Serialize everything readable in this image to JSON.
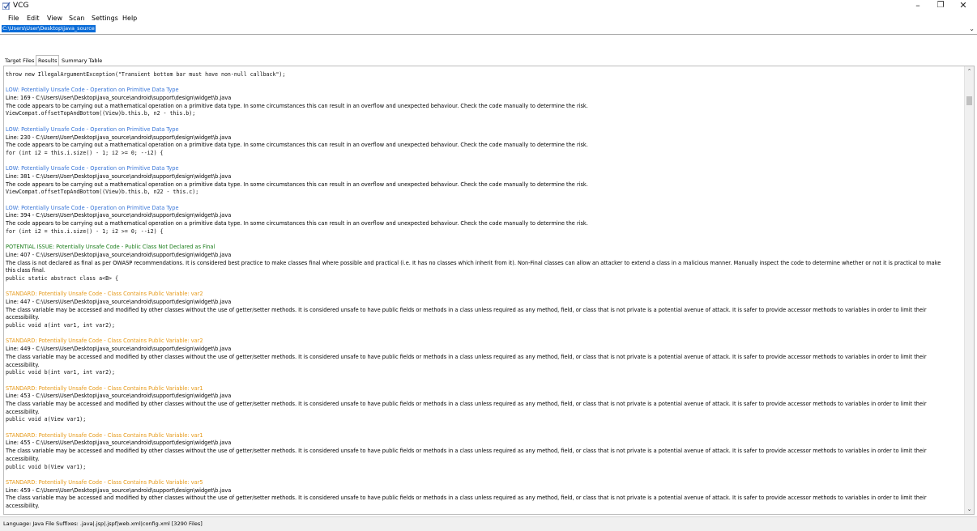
{
  "window": {
    "title": "VCG",
    "minimize": "–",
    "maximize": "❐",
    "close": "✕"
  },
  "menu": [
    "File",
    "Edit",
    "View",
    "Scan",
    "Settings",
    "Help"
  ],
  "path": {
    "value": "C:\\Users\\User\\Desktop\\java_source",
    "dropdown": "⌄"
  },
  "tabs": [
    "Target Files",
    "Results",
    "Summary Table"
  ],
  "scrollbar": {
    "up": "⌃",
    "down": "⌄"
  },
  "results": {
    "top_code": "    throw new IllegalArgumentException(\"Transient bottom bar must have non-null callback\");",
    "entries": [
      {
        "heading": "LOW: Potentially Unsafe Code - Operation on Primitive Data Type",
        "line": "Line: 169 - C:\\Users\\User\\Desktop\\java_source\\android\\support\\design\\widget\\b.java",
        "desc": "The code appears to be carrying out a mathematical operation on a primitive data type. In some circumstances this can result in an overflow and unexpected behaviour. Check the code manually to determine the risk.",
        "code": "                 ViewCompat.offsetTopAndBottom((View)b.this.b, n2 - this.b);"
      },
      {
        "heading": "LOW: Potentially Unsafe Code - Operation on Primitive Data Type",
        "line": "Line: 230 - C:\\Users\\User\\Desktop\\java_source\\android\\support\\design\\widget\\b.java",
        "desc": "The code appears to be carrying out a mathematical operation on a primitive data type. In some circumstances this can result in an overflow and unexpected behaviour. Check the code manually to determine the risk.",
        "code": "        for (int i2 = this.i.size() - 1; i2 >= 0; --i2) {"
      },
      {
        "heading": "LOW: Potentially Unsafe Code - Operation on Primitive Data Type",
        "line": "Line: 381 - C:\\Users\\User\\Desktop\\java_source\\android\\support\\design\\widget\\b.java",
        "desc": "The code appears to be carrying out a mathematical operation on a primitive data type. In some circumstances this can result in an overflow and unexpected behaviour. Check the code manually to determine the risk.",
        "code": "              ViewCompat.offsetTopAndBottom((View)b.this.b, n22 - this.c);"
      },
      {
        "heading": "LOW: Potentially Unsafe Code - Operation on Primitive Data Type",
        "line": "Line: 394 - C:\\Users\\User\\Desktop\\java_source\\android\\support\\design\\widget\\b.java",
        "desc": "The code appears to be carrying out a mathematical operation on a primitive data type. In some circumstances this can result in an overflow and unexpected behaviour. Check the code manually to determine the risk.",
        "code": "        for (int i2 = this.i.size() - 1; i2 >= 0; --i2) {"
      },
      {
        "heading": "POTENTIAL ISSUE: Potentially Unsafe Code - Public Class Not Declared as Final",
        "line": "Line: 407 - C:\\Users\\User\\Desktop\\java_source\\android\\support\\design\\widget\\b.java",
        "desc": "The class is not declared as final as per OWASP recommendations. It is considered best practice to make classes final where possible and practical (i.e. It has no classes which inherit from it). Non-Final classes can allow an attacker to extend a class in a malicious manner. Manually inspect the code to determine whether or not it is practical to make this class final.",
        "code": "    public static abstract class a<B> {"
      },
      {
        "heading": "STANDARD: Potentially Unsafe Code - Class Contains Public Variable: var2",
        "line": "Line: 447 - C:\\Users\\User\\Desktop\\java_source\\android\\support\\design\\widget\\b.java",
        "desc": "The class variable may be accessed and modified by other classes without the use of getter/setter methods. It is considered unsafe to have public fields or methods in a class unless required as any method, field, or class that is not private is a potential avenue of attack. It is safer to provide accessor methods to variables in order to limit their accessibility.",
        "code": "        public void a(int var1, int var2);"
      },
      {
        "heading": "STANDARD: Potentially Unsafe Code - Class Contains Public Variable: var2",
        "line": "Line: 449 - C:\\Users\\User\\Desktop\\java_source\\android\\support\\design\\widget\\b.java",
        "desc": "The class variable may be accessed and modified by other classes without the use of getter/setter methods. It is considered unsafe to have public fields or methods in a class unless required as any method, field, or class that is not private is a potential avenue of attack. It is safer to provide accessor methods to variables in order to limit their accessibility.",
        "code": "        public void b(int var1, int var2);"
      },
      {
        "heading": "STANDARD: Potentially Unsafe Code - Class Contains Public Variable: var1",
        "line": "Line: 453 - C:\\Users\\User\\Desktop\\java_source\\android\\support\\design\\widget\\b.java",
        "desc": "The class variable may be accessed and modified by other classes without the use of getter/setter methods. It is considered unsafe to have public fields or methods in a class unless required as any method, field, or class that is not private is a potential avenue of attack. It is safer to provide accessor methods to variables in order to limit their accessibility.",
        "code": "        public void a(View var1);"
      },
      {
        "heading": "STANDARD: Potentially Unsafe Code - Class Contains Public Variable: var1",
        "line": "Line: 455 - C:\\Users\\User\\Desktop\\java_source\\android\\support\\design\\widget\\b.java",
        "desc": "The class variable may be accessed and modified by other classes without the use of getter/setter methods. It is considered unsafe to have public fields or methods in a class unless required as any method, field, or class that is not private is a potential avenue of attack. It is safer to provide accessor methods to variables in order to limit their accessibility.",
        "code": "        public void b(View var1);"
      },
      {
        "heading": "STANDARD: Potentially Unsafe Code - Class Contains Public Variable: var5",
        "line": "Line: 459 - C:\\Users\\User\\Desktop\\java_source\\android\\support\\design\\widget\\b.java",
        "desc": "The class variable may be accessed and modified by other classes without the use of getter/setter methods. It is considered unsafe to have public fields or methods in a class unless required as any method, field, or class that is not private is a potential avenue of attack. It is safer to provide accessor methods to variables in order to limit their accessibility.",
        "code": ""
      }
    ]
  },
  "status": "Language: Java   File Suffixes: .java|.jsp|.jspf|web.xml|config.xml   [3290 Files]",
  "colors": {
    "low": "#3c78d8",
    "potential": "#1b7d1b",
    "standard": "#e69a1a",
    "selection": "#0a6cd8"
  }
}
